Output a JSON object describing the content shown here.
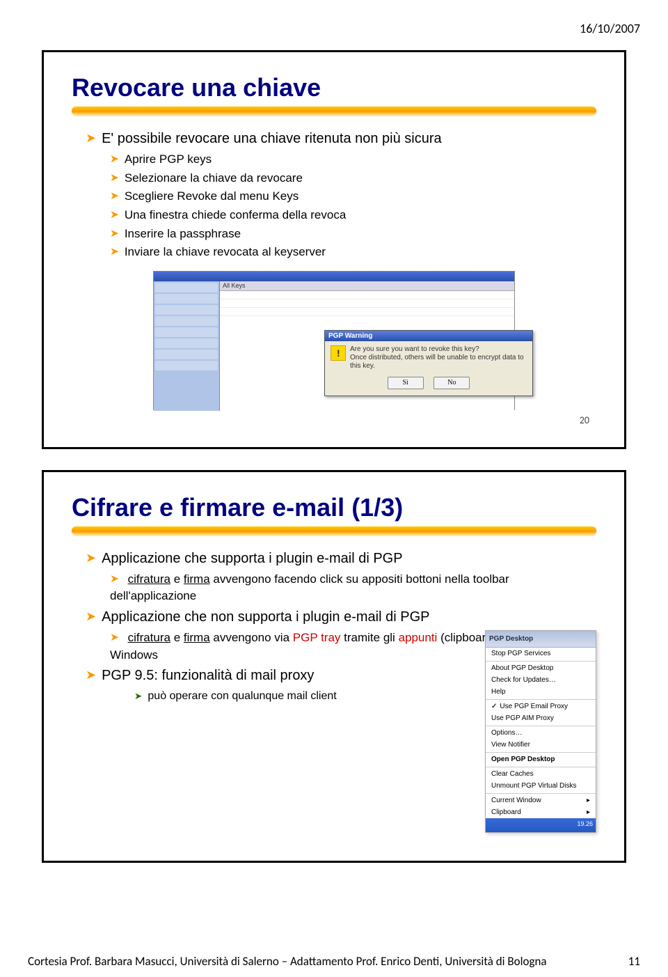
{
  "header": {
    "date": "16/10/2007"
  },
  "slide1": {
    "title": "Revocare una chiave",
    "b0": "E' possibile revocare una chiave ritenuta non più sicura",
    "b1": "Aprire PGP keys",
    "b2": "Selezionare la chiave da revocare",
    "b3": "Scegliere Revoke dal menu Keys",
    "b4": "Una finestra chiede conferma della revoca",
    "b5": "Inserire la passphrase",
    "b6": "Inviare la chiave revocata al keyserver",
    "screenshot": {
      "listhead": "All Keys",
      "dlg_title": "PGP Warning",
      "dlg_line1": "Are you sure you want to revoke this key?",
      "dlg_line2": "Once distributed, others will be unable to encrypt data to this key.",
      "btn_yes": "Sì",
      "btn_no": "No"
    },
    "foot": "20"
  },
  "slide2": {
    "title": "Cifrare e firmare e-mail (1/3)",
    "b0": "Applicazione che supporta i plugin e-mail di PGP",
    "b1pre": "cifratura",
    "b1mid": " e ",
    "b1firma": "firma",
    "b1post": " avvengono facendo click su appositi bottoni nella toolbar dell'applicazione",
    "b2": "Applicazione che non supporta i plugin e-mail di PGP",
    "b3pre": "cifratura",
    "b3mid": " e ",
    "b3firma": "firma",
    "b3post": " avvengono via ",
    "b3tray": "PGP tray",
    "b3post2": " tramite gli ",
    "b3app": "appunti",
    "b3tail": " (clipboard) di Windows",
    "b4": "PGP 9.5: funzionalità di mail proxy",
    "b5": "può operare con qualunque mail client",
    "tray": {
      "hdr": "PGP Desktop",
      "i0": "Stop PGP Services",
      "i1": "About PGP Desktop",
      "i2": "Check for Updates…",
      "i3": "Help",
      "i4": "Use PGP Email Proxy",
      "i5": "Use PGP AIM Proxy",
      "i6": "Options…",
      "i7": "View Notifier",
      "i8": "Open PGP Desktop",
      "i9": "Clear Caches",
      "i10": "Unmount PGP Virtual Disks",
      "i11": "Current Window",
      "i12": "Clipboard",
      "clock": "19.26"
    }
  },
  "footer": {
    "credit": "Cortesia Prof. Barbara Masucci, Università di Salerno – Adattamento Prof. Enrico Denti, Università di Bologna",
    "page": "11"
  }
}
